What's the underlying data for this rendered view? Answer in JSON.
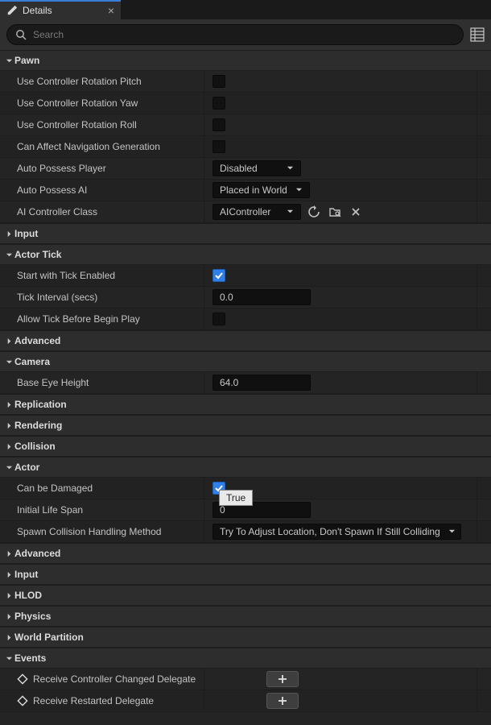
{
  "panel": {
    "title": "Details"
  },
  "search": {
    "placeholder": "Search"
  },
  "tooltip": "True",
  "cat": {
    "pawn": "Pawn",
    "input": "Input",
    "actor_tick": "Actor Tick",
    "advanced": "Advanced",
    "camera": "Camera",
    "replication": "Replication",
    "rendering": "Rendering",
    "collision": "Collision",
    "actor": "Actor",
    "input2": "Input",
    "hlod": "HLOD",
    "physics": "Physics",
    "world_partition": "World Partition",
    "events": "Events"
  },
  "pawn": {
    "use_controller_rotation_pitch": {
      "label": "Use Controller Rotation Pitch",
      "checked": false
    },
    "use_controller_rotation_yaw": {
      "label": "Use Controller Rotation Yaw",
      "checked": false
    },
    "use_controller_rotation_roll": {
      "label": "Use Controller Rotation Roll",
      "checked": false
    },
    "can_affect_nav_gen": {
      "label": "Can Affect Navigation Generation",
      "checked": false
    },
    "auto_possess_player": {
      "label": "Auto Possess Player",
      "value": "Disabled"
    },
    "auto_possess_ai": {
      "label": "Auto Possess AI",
      "value": "Placed in World"
    },
    "ai_controller_class": {
      "label": "AI Controller Class",
      "value": "AIController"
    }
  },
  "actor_tick": {
    "start_with_tick_enabled": {
      "label": "Start with Tick Enabled",
      "checked": true
    },
    "tick_interval": {
      "label": "Tick Interval (secs)",
      "value": "0.0"
    },
    "allow_tick_before_begin": {
      "label": "Allow Tick Before Begin Play",
      "checked": false
    }
  },
  "camera": {
    "base_eye_height": {
      "label": "Base Eye Height",
      "value": "64.0"
    }
  },
  "actor": {
    "can_be_damaged": {
      "label": "Can be Damaged",
      "checked": true
    },
    "initial_life_span": {
      "label": "Initial Life Span",
      "value": "0"
    },
    "spawn_collision": {
      "label": "Spawn Collision Handling Method",
      "value": "Try To Adjust Location, Don't Spawn If Still Colliding"
    }
  },
  "events": {
    "receive_controller_changed": "Receive Controller Changed Delegate",
    "receive_restarted": "Receive Restarted Delegate"
  }
}
